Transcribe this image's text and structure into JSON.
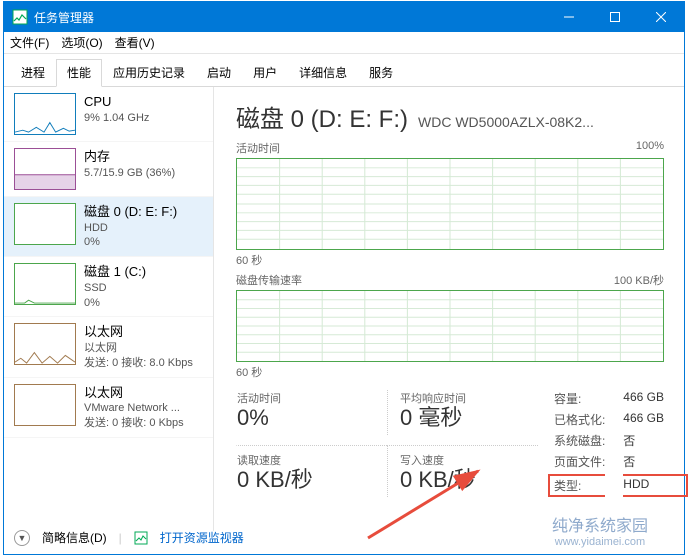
{
  "window": {
    "title": "任务管理器"
  },
  "menu": {
    "file": "文件(F)",
    "options": "选项(O)",
    "view": "查看(V)"
  },
  "tabs": [
    "进程",
    "性能",
    "应用历史记录",
    "启动",
    "用户",
    "详细信息",
    "服务"
  ],
  "active_tab": 1,
  "sidebar": {
    "items": [
      {
        "name": "CPU",
        "sub1": "9% 1.04 GHz",
        "sub2": ""
      },
      {
        "name": "内存",
        "sub1": "5.7/15.9 GB (36%)",
        "sub2": ""
      },
      {
        "name": "磁盘 0 (D: E: F:)",
        "sub1": "HDD",
        "sub2": "0%"
      },
      {
        "name": "磁盘 1 (C:)",
        "sub1": "SSD",
        "sub2": "0%"
      },
      {
        "name": "以太网",
        "sub1": "以太网",
        "sub2": "发送: 0 接收: 8.0 Kbps"
      },
      {
        "name": "以太网",
        "sub1": "VMware Network ...",
        "sub2": "发送: 0 接收: 0 Kbps"
      }
    ],
    "selected": 2
  },
  "main": {
    "disk_title": "磁盘 0 (D: E: F:)",
    "model": "WDC WD5000AZLX-08K2...",
    "g1_label": "活动时间",
    "g1_max": "100%",
    "g1_x": "60 秒",
    "g2_label": "磁盘传输速率",
    "g2_max": "100 KB/秒",
    "g2_x": "60 秒",
    "stats": {
      "active_label": "活动时间",
      "active_val": "0%",
      "resp_label": "平均响应时间",
      "resp_val": "0 毫秒",
      "read_label": "读取速度",
      "read_val": "0 KB/秒",
      "write_label": "写入速度",
      "write_val": "0 KB/秒"
    },
    "info": {
      "capacity_l": "容量:",
      "capacity_v": "466 GB",
      "formatted_l": "已格式化:",
      "formatted_v": "466 GB",
      "system_l": "系统磁盘:",
      "system_v": "否",
      "pagefile_l": "页面文件:",
      "pagefile_v": "否",
      "type_l": "类型:",
      "type_v": "HDD"
    }
  },
  "footer": {
    "brief": "简略信息(D)",
    "monitor": "打开资源监视器"
  },
  "watermark": {
    "line1": "纯净系统家园",
    "line2": "www.yidaimei.com"
  },
  "chart_data": [
    {
      "type": "line",
      "title": "活动时间",
      "ylabel": "%",
      "ylim": [
        0,
        100
      ],
      "x_span_seconds": 60,
      "values_approx": "near-zero flatline"
    },
    {
      "type": "line",
      "title": "磁盘传输速率",
      "ylabel": "KB/秒",
      "ylim": [
        0,
        100
      ],
      "x_span_seconds": 60,
      "values_approx": "near-zero flatline"
    }
  ]
}
